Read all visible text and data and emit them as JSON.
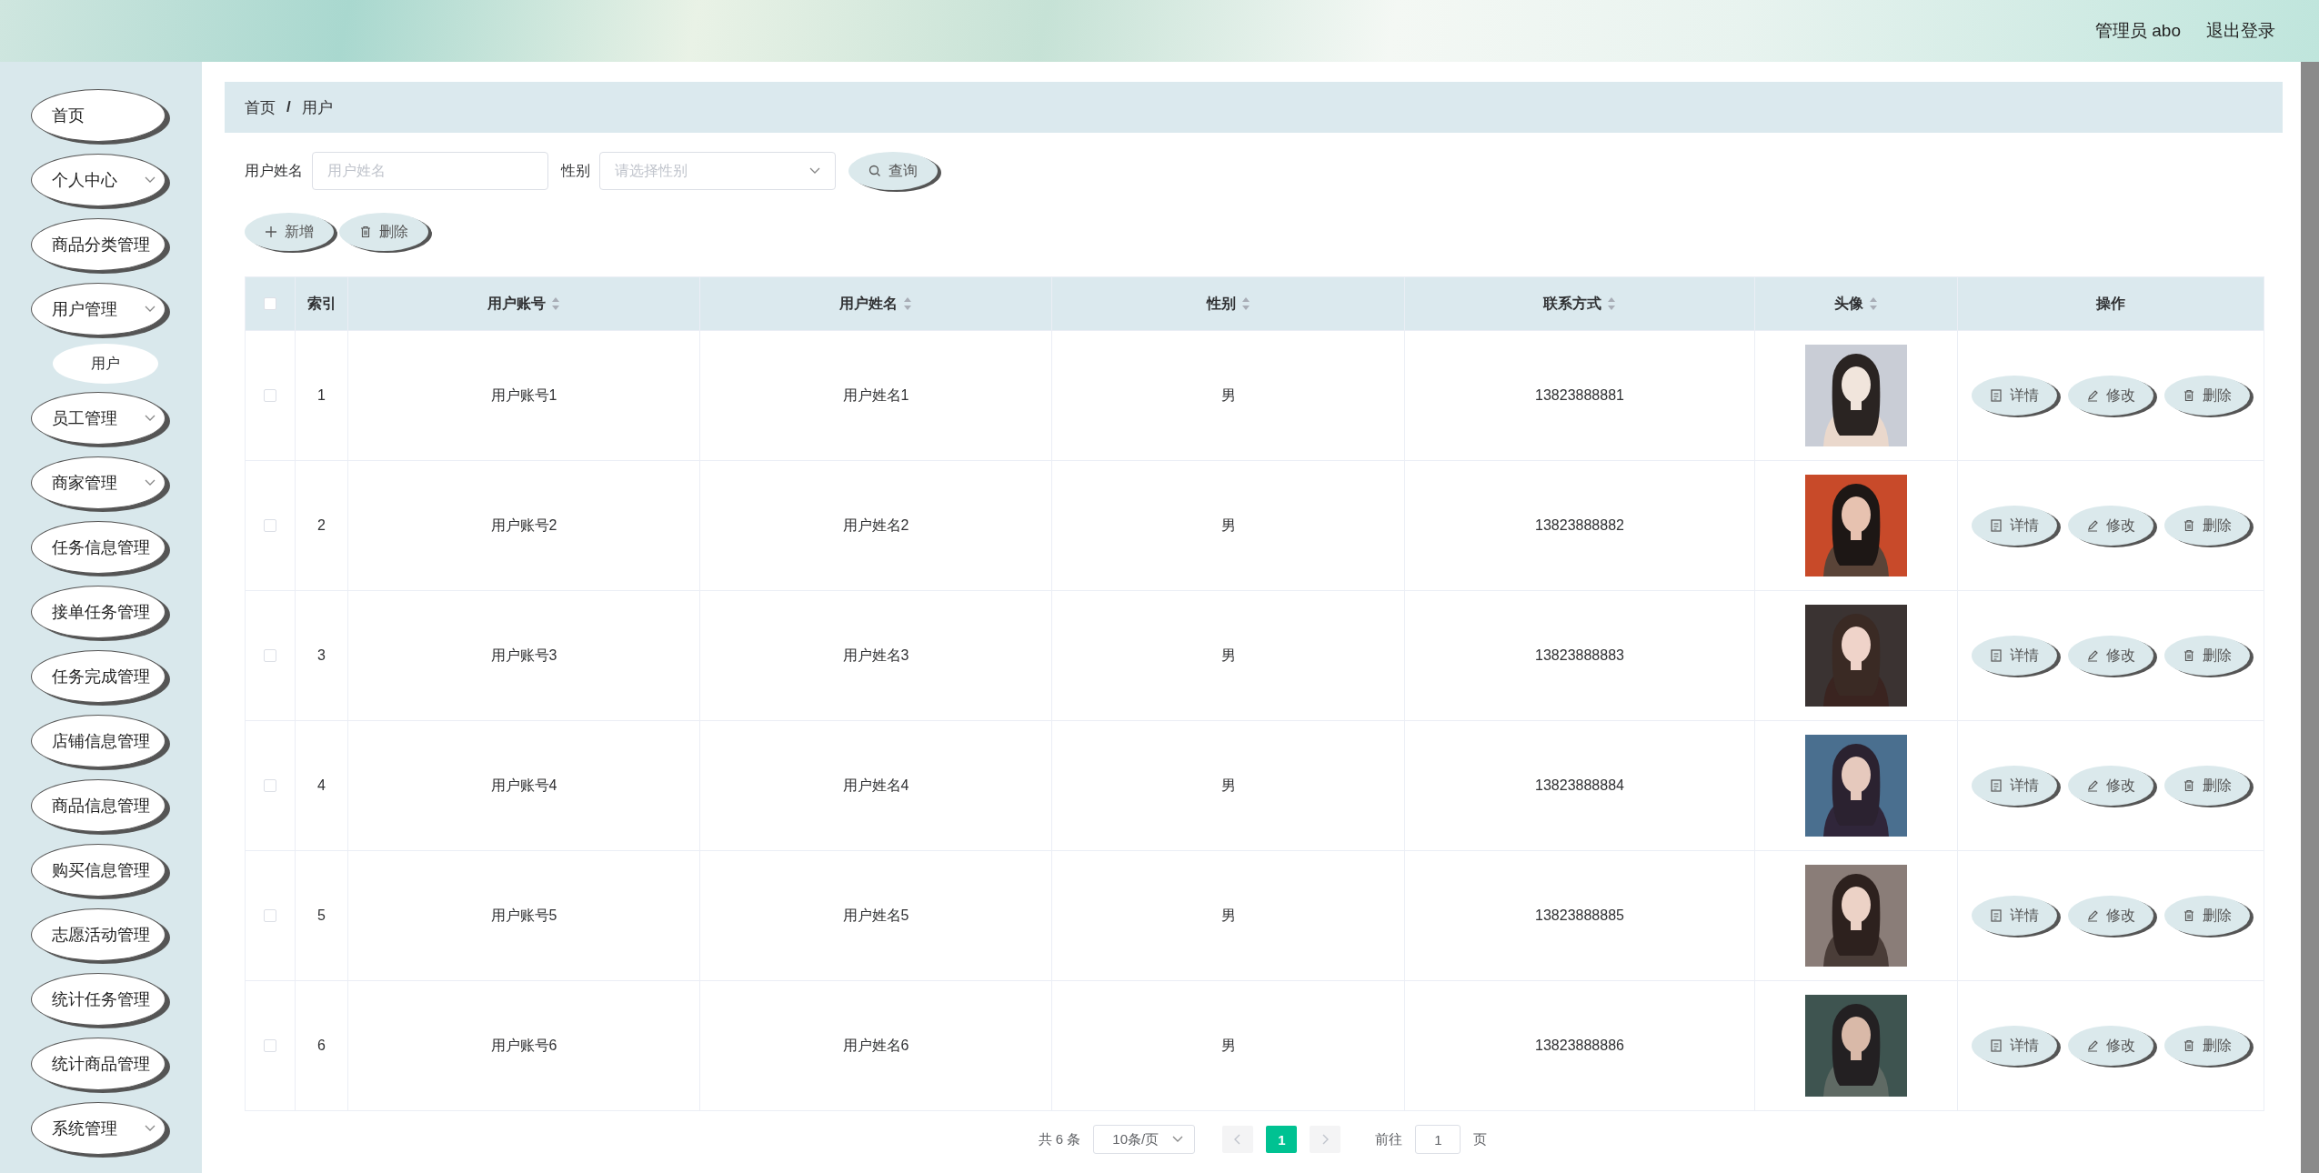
{
  "header": {
    "user_label": "管理员 abo",
    "logout": "退出登录"
  },
  "sidebar": {
    "items": [
      {
        "label": "首页",
        "kind": "link"
      },
      {
        "label": "个人中心",
        "kind": "submenu"
      },
      {
        "label": "商品分类管理",
        "kind": "link"
      },
      {
        "label": "用户管理",
        "kind": "submenu",
        "children": [
          {
            "label": "用户"
          }
        ]
      },
      {
        "label": "员工管理",
        "kind": "submenu"
      },
      {
        "label": "商家管理",
        "kind": "submenu"
      },
      {
        "label": "任务信息管理",
        "kind": "link"
      },
      {
        "label": "接单任务管理",
        "kind": "link"
      },
      {
        "label": "任务完成管理",
        "kind": "link"
      },
      {
        "label": "店铺信息管理",
        "kind": "link"
      },
      {
        "label": "商品信息管理",
        "kind": "link"
      },
      {
        "label": "购买信息管理",
        "kind": "link"
      },
      {
        "label": "志愿活动管理",
        "kind": "link"
      },
      {
        "label": "统计任务管理",
        "kind": "link"
      },
      {
        "label": "统计商品管理",
        "kind": "link"
      },
      {
        "label": "系统管理",
        "kind": "submenu"
      }
    ]
  },
  "breadcrumb": {
    "separator": "/",
    "items": [
      "首页",
      "用户"
    ]
  },
  "search": {
    "fields": [
      {
        "label": "用户姓名",
        "kind": "input",
        "placeholder": "用户姓名"
      },
      {
        "label": "性别",
        "kind": "select",
        "placeholder": "请选择性别"
      }
    ],
    "button": "查询"
  },
  "toolbar": [
    {
      "label": "新增",
      "kind": "add"
    },
    {
      "label": "删除",
      "kind": "delete"
    }
  ],
  "table": {
    "select_all": {
      "checked": false
    },
    "columns": [
      {
        "label": "索引",
        "sortable": false
      },
      {
        "label": "用户账号",
        "sortable": true
      },
      {
        "label": "用户姓名",
        "sortable": true
      },
      {
        "label": "性别",
        "sortable": true
      },
      {
        "label": "联系方式",
        "sortable": true
      },
      {
        "label": "头像",
        "sortable": true
      },
      {
        "label": "操作",
        "sortable": false
      }
    ],
    "rows": [
      {
        "checked": false,
        "index": "1",
        "account": "用户账号1",
        "name": "用户姓名1",
        "gender": "男",
        "phone": "13823888881",
        "actions": [
          {
            "label": "详情",
            "kind": "detail"
          },
          {
            "label": "修改",
            "kind": "edit"
          },
          {
            "label": "删除",
            "kind": "delete"
          }
        ]
      },
      {
        "checked": false,
        "index": "2",
        "account": "用户账号2",
        "name": "用户姓名2",
        "gender": "男",
        "phone": "13823888882",
        "actions": [
          {
            "label": "详情",
            "kind": "detail"
          },
          {
            "label": "修改",
            "kind": "edit"
          },
          {
            "label": "删除",
            "kind": "delete"
          }
        ]
      },
      {
        "checked": false,
        "index": "3",
        "account": "用户账号3",
        "name": "用户姓名3",
        "gender": "男",
        "phone": "13823888883",
        "actions": [
          {
            "label": "详情",
            "kind": "detail"
          },
          {
            "label": "修改",
            "kind": "edit"
          },
          {
            "label": "删除",
            "kind": "delete"
          }
        ]
      },
      {
        "checked": false,
        "index": "4",
        "account": "用户账号4",
        "name": "用户姓名4",
        "gender": "男",
        "phone": "13823888884",
        "actions": [
          {
            "label": "详情",
            "kind": "detail"
          },
          {
            "label": "修改",
            "kind": "edit"
          },
          {
            "label": "删除",
            "kind": "delete"
          }
        ]
      },
      {
        "checked": false,
        "index": "5",
        "account": "用户账号5",
        "name": "用户姓名5",
        "gender": "男",
        "phone": "13823888885",
        "actions": [
          {
            "label": "详情",
            "kind": "detail"
          },
          {
            "label": "修改",
            "kind": "edit"
          },
          {
            "label": "删除",
            "kind": "delete"
          }
        ]
      },
      {
        "checked": false,
        "index": "6",
        "account": "用户账号6",
        "name": "用户姓名6",
        "gender": "男",
        "phone": "13823888886",
        "actions": [
          {
            "label": "详情",
            "kind": "detail"
          },
          {
            "label": "修改",
            "kind": "edit"
          },
          {
            "label": "删除",
            "kind": "delete"
          }
        ]
      }
    ]
  },
  "pagination": {
    "total": "共 6 条",
    "page_size": "10条/页",
    "pages": [
      {
        "label": "1",
        "selected": true
      }
    ],
    "goto_label": "前往",
    "goto_value": "1",
    "goto_suffix": "页"
  }
}
